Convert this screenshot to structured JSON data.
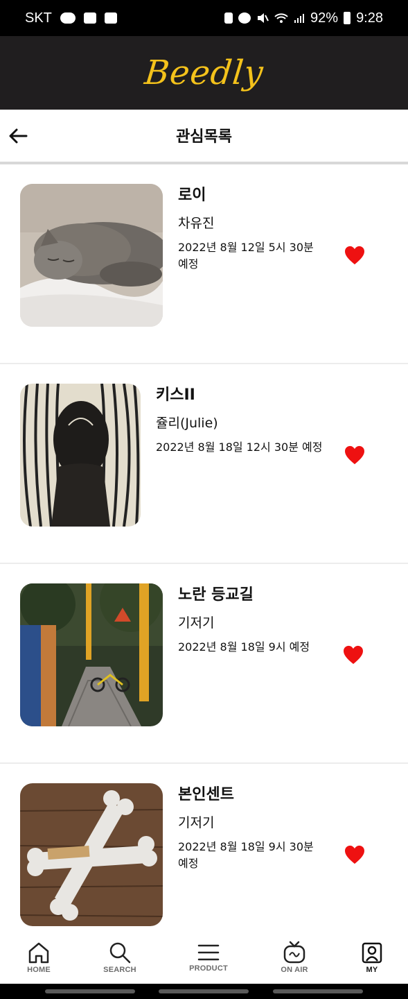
{
  "status_bar": {
    "carrier": "SKT",
    "battery": "92%",
    "time": "9:28",
    "left_icons": [
      "talk-icon",
      "message-icon",
      "gallery-icon"
    ],
    "right_icons": [
      "battery-saver-icon",
      "alarm-icon",
      "mute-icon",
      "wifi-icon",
      "signal-icon",
      "battery-icon"
    ]
  },
  "app": {
    "logo": "Beedly",
    "brand_color": "#f4c21b",
    "header_bg": "#201e1f"
  },
  "header": {
    "title": "관심목록",
    "back_icon": "arrow-left-icon"
  },
  "items": [
    {
      "title": "로이",
      "artist": "차유진",
      "date": "2022년 8월 12일 5시 30분 예정",
      "liked": true
    },
    {
      "title": "키스II",
      "artist": "쥴리(Julie)",
      "date": "2022년 8월 18일 12시 30분 예정",
      "liked": true
    },
    {
      "title": "노란 등교길",
      "artist": "기저기",
      "date": "2022년 8월 18일 9시 예정",
      "liked": true
    },
    {
      "title": "본인센트",
      "artist": "기저기",
      "date": "2022년 8월 18일 9시 30분 예정",
      "liked": true
    }
  ],
  "heart_color": "#ee1111",
  "nav": [
    {
      "label": "HOME",
      "icon": "home-icon",
      "active": false
    },
    {
      "label": "SEARCH",
      "icon": "search-icon",
      "active": false
    },
    {
      "label": "PRODUCT",
      "icon": "menu-icon",
      "active": false
    },
    {
      "label": "ON AIR",
      "icon": "tv-icon",
      "active": false
    },
    {
      "label": "MY",
      "icon": "profile-icon",
      "active": true
    }
  ]
}
